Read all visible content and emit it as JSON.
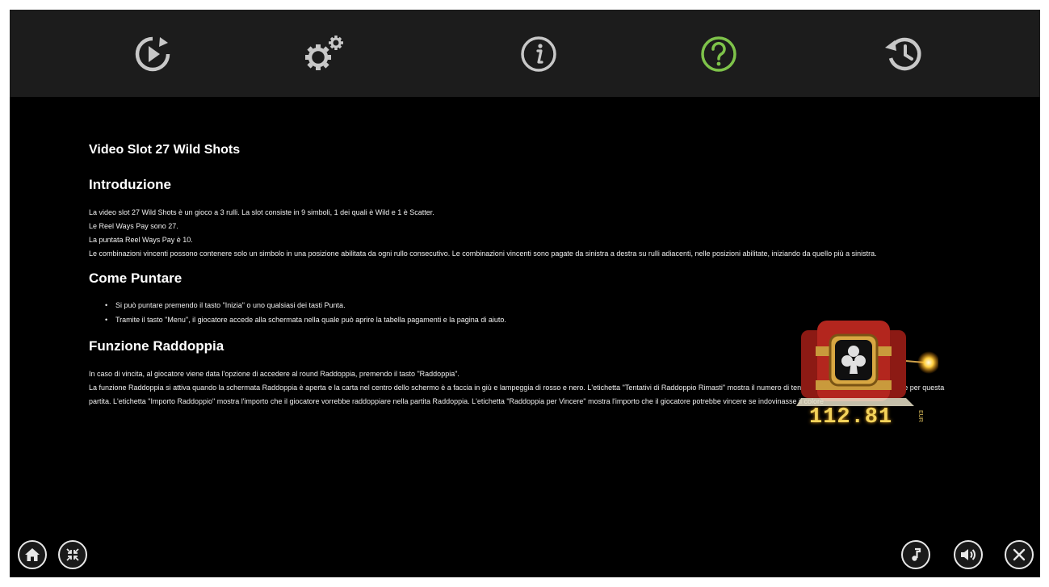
{
  "tabs": [
    {
      "name": "replay",
      "icon": "replay-icon",
      "active": false
    },
    {
      "name": "settings",
      "icon": "gears-icon",
      "active": false
    },
    {
      "name": "info",
      "icon": "info-icon",
      "active": false
    },
    {
      "name": "help",
      "icon": "help-icon",
      "active": true
    },
    {
      "name": "history",
      "icon": "history-icon",
      "active": false
    }
  ],
  "colors": {
    "active_tab": "#7ec34a",
    "inactive_tab": "#c8c8c8",
    "topbar": "#1c1c1c",
    "balance": "#f4d35a"
  },
  "content": {
    "title": "Video Slot 27 Wild Shots",
    "intro": {
      "heading": "Introduzione",
      "lines": [
        "La video slot 27 Wild Shots è un gioco a 3 rulli. La slot consiste in 9 simboli, 1 dei quali è Wild e 1 è Scatter.",
        "Le Reel Ways Pay sono 27.",
        "La puntata Reel Ways Pay è 10.",
        "Le combinazioni vincenti possono contenere solo un simbolo in una posizione abilitata da ogni rullo consecutivo. Le combinazioni vincenti sono pagate da sinistra a destra su rulli adiacenti, nelle posizioni abilitate, iniziando da quello più a sinistra."
      ]
    },
    "bet": {
      "heading": "Come Puntare",
      "bullets": [
        "Si può puntare premendo il tasto \"Inizia\" o uno qualsiasi dei tasti Punta.",
        "Tramite il tasto \"Menu\", il giocatore accede alla schermata nella quale può aprire la tabella pagamenti e la pagina di aiuto."
      ]
    },
    "double": {
      "heading": "Funzione Raddoppia",
      "lines": [
        "In caso di vincita, al giocatore viene data l'opzione di accedere al round Raddoppia, premendo il tasto \"Raddoppia\".",
        "La funzione Raddoppia si attiva quando la schermata Raddoppia è aperta e la carta nel centro dello schermo è a faccia in giù e lampeggia di rosso e nero. L'etichetta \"Tentativi di Raddoppio Rimasti\" mostra il numero di tentativi a disposizione del giocatore per questa partita. L'etichetta \"Importo Raddoppio\" mostra l'importo che il giocatore vorrebbe raddoppiare nella partita Raddoppia. L'etichetta \"Raddoppia per Vincere\" mostra l'importo che il giocatore potrebbe vincere se indovinasse il colore"
      ]
    }
  },
  "balance": {
    "amount": "112.81",
    "currency": "EUR"
  },
  "bottom_left": [
    {
      "name": "home",
      "icon": "home-icon"
    },
    {
      "name": "minimize",
      "icon": "minimize-icon"
    }
  ],
  "bottom_right": [
    {
      "name": "music",
      "icon": "music-note-icon"
    },
    {
      "name": "sound",
      "icon": "speaker-icon"
    },
    {
      "name": "close",
      "icon": "close-icon"
    }
  ]
}
